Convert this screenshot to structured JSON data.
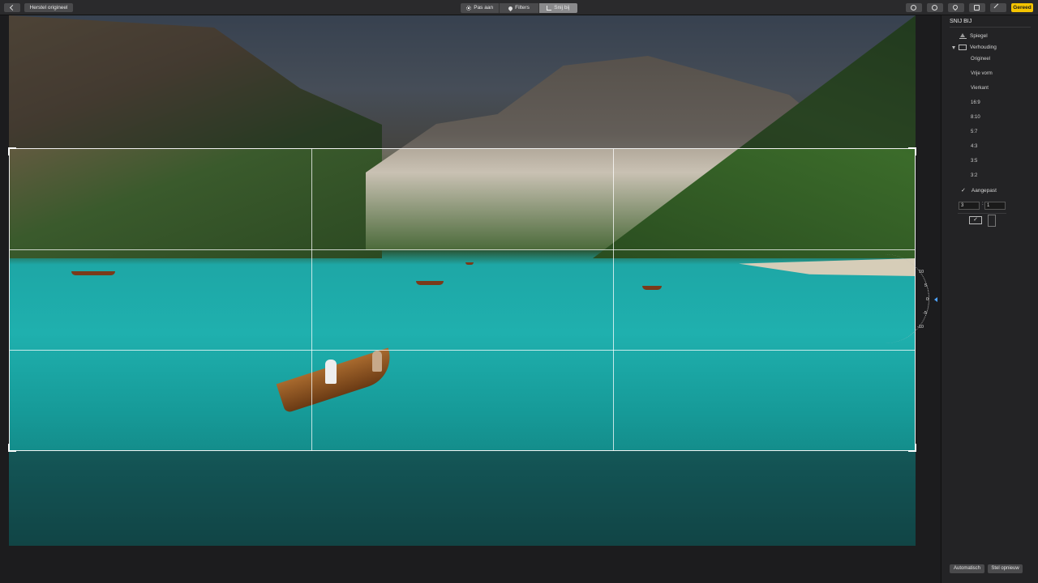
{
  "toolbar": {
    "revert_label": "Herstel origineel",
    "tabs": [
      {
        "label": "Pas aan",
        "icon": "sun-icon"
      },
      {
        "label": "Filters",
        "icon": "drop-icon"
      },
      {
        "label": "Snij bij",
        "icon": "crop-icon",
        "active": true
      }
    ],
    "right_icons": [
      "info-icon",
      "more-icon",
      "heart-icon",
      "rotate-icon",
      "wand-icon"
    ],
    "done_label": "Gereed",
    "done_color": "#f5c400"
  },
  "photo": {
    "subject": "turquoise mountain lake with rowing boats",
    "crop_grid": "rule-of-thirds"
  },
  "dial": {
    "labels": [
      "10",
      "5",
      "0",
      "-5",
      "-10"
    ],
    "pointer_value": 0,
    "pointer_color": "#4da3ff"
  },
  "sidebar": {
    "title": "SNIJ BIJ",
    "flip_label": "Spiegel",
    "aspect_label": "Verhouding",
    "aspect_items": [
      "Origineel",
      "Vrije vorm",
      "Vierkant",
      "16:9",
      "8:10",
      "5:7",
      "4:3",
      "3:5",
      "3:2"
    ],
    "custom_label": "Aangepast",
    "custom_checked": true,
    "ratio_w": "3",
    "ratio_h": "1",
    "ratio_sep": ":",
    "landscape_checked": true,
    "auto_label": "Automatisch",
    "reset_label": "Stel opnieuw"
  }
}
